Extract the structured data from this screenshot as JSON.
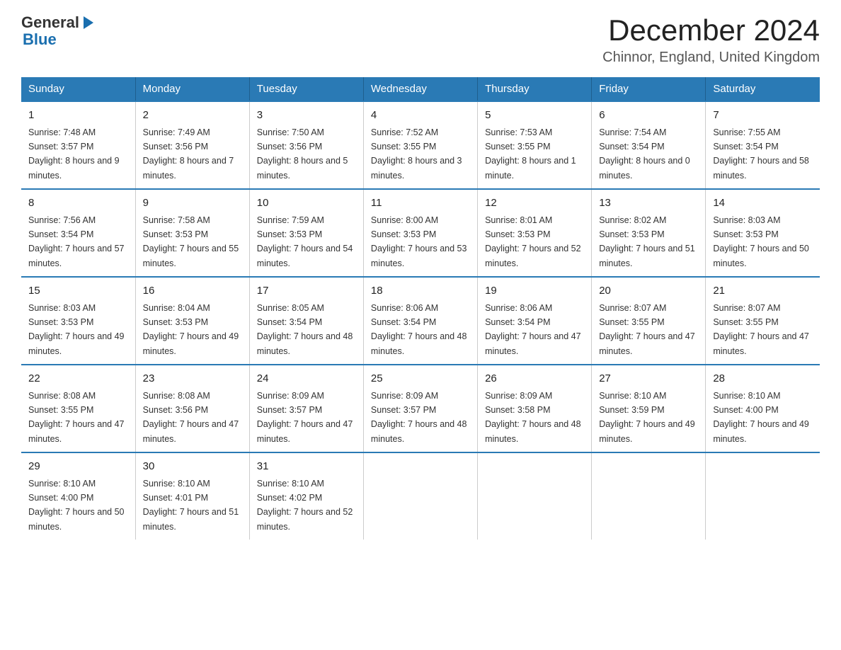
{
  "header": {
    "logo_general": "General",
    "logo_blue": "Blue",
    "title": "December 2024",
    "subtitle": "Chinnor, England, United Kingdom"
  },
  "weekdays": [
    "Sunday",
    "Monday",
    "Tuesday",
    "Wednesday",
    "Thursday",
    "Friday",
    "Saturday"
  ],
  "weeks": [
    [
      {
        "day": "1",
        "sunrise": "7:48 AM",
        "sunset": "3:57 PM",
        "daylight": "8 hours and 9 minutes."
      },
      {
        "day": "2",
        "sunrise": "7:49 AM",
        "sunset": "3:56 PM",
        "daylight": "8 hours and 7 minutes."
      },
      {
        "day": "3",
        "sunrise": "7:50 AM",
        "sunset": "3:56 PM",
        "daylight": "8 hours and 5 minutes."
      },
      {
        "day": "4",
        "sunrise": "7:52 AM",
        "sunset": "3:55 PM",
        "daylight": "8 hours and 3 minutes."
      },
      {
        "day": "5",
        "sunrise": "7:53 AM",
        "sunset": "3:55 PM",
        "daylight": "8 hours and 1 minute."
      },
      {
        "day": "6",
        "sunrise": "7:54 AM",
        "sunset": "3:54 PM",
        "daylight": "8 hours and 0 minutes."
      },
      {
        "day": "7",
        "sunrise": "7:55 AM",
        "sunset": "3:54 PM",
        "daylight": "7 hours and 58 minutes."
      }
    ],
    [
      {
        "day": "8",
        "sunrise": "7:56 AM",
        "sunset": "3:54 PM",
        "daylight": "7 hours and 57 minutes."
      },
      {
        "day": "9",
        "sunrise": "7:58 AM",
        "sunset": "3:53 PM",
        "daylight": "7 hours and 55 minutes."
      },
      {
        "day": "10",
        "sunrise": "7:59 AM",
        "sunset": "3:53 PM",
        "daylight": "7 hours and 54 minutes."
      },
      {
        "day": "11",
        "sunrise": "8:00 AM",
        "sunset": "3:53 PM",
        "daylight": "7 hours and 53 minutes."
      },
      {
        "day": "12",
        "sunrise": "8:01 AM",
        "sunset": "3:53 PM",
        "daylight": "7 hours and 52 minutes."
      },
      {
        "day": "13",
        "sunrise": "8:02 AM",
        "sunset": "3:53 PM",
        "daylight": "7 hours and 51 minutes."
      },
      {
        "day": "14",
        "sunrise": "8:03 AM",
        "sunset": "3:53 PM",
        "daylight": "7 hours and 50 minutes."
      }
    ],
    [
      {
        "day": "15",
        "sunrise": "8:03 AM",
        "sunset": "3:53 PM",
        "daylight": "7 hours and 49 minutes."
      },
      {
        "day": "16",
        "sunrise": "8:04 AM",
        "sunset": "3:53 PM",
        "daylight": "7 hours and 49 minutes."
      },
      {
        "day": "17",
        "sunrise": "8:05 AM",
        "sunset": "3:54 PM",
        "daylight": "7 hours and 48 minutes."
      },
      {
        "day": "18",
        "sunrise": "8:06 AM",
        "sunset": "3:54 PM",
        "daylight": "7 hours and 48 minutes."
      },
      {
        "day": "19",
        "sunrise": "8:06 AM",
        "sunset": "3:54 PM",
        "daylight": "7 hours and 47 minutes."
      },
      {
        "day": "20",
        "sunrise": "8:07 AM",
        "sunset": "3:55 PM",
        "daylight": "7 hours and 47 minutes."
      },
      {
        "day": "21",
        "sunrise": "8:07 AM",
        "sunset": "3:55 PM",
        "daylight": "7 hours and 47 minutes."
      }
    ],
    [
      {
        "day": "22",
        "sunrise": "8:08 AM",
        "sunset": "3:55 PM",
        "daylight": "7 hours and 47 minutes."
      },
      {
        "day": "23",
        "sunrise": "8:08 AM",
        "sunset": "3:56 PM",
        "daylight": "7 hours and 47 minutes."
      },
      {
        "day": "24",
        "sunrise": "8:09 AM",
        "sunset": "3:57 PM",
        "daylight": "7 hours and 47 minutes."
      },
      {
        "day": "25",
        "sunrise": "8:09 AM",
        "sunset": "3:57 PM",
        "daylight": "7 hours and 48 minutes."
      },
      {
        "day": "26",
        "sunrise": "8:09 AM",
        "sunset": "3:58 PM",
        "daylight": "7 hours and 48 minutes."
      },
      {
        "day": "27",
        "sunrise": "8:10 AM",
        "sunset": "3:59 PM",
        "daylight": "7 hours and 49 minutes."
      },
      {
        "day": "28",
        "sunrise": "8:10 AM",
        "sunset": "4:00 PM",
        "daylight": "7 hours and 49 minutes."
      }
    ],
    [
      {
        "day": "29",
        "sunrise": "8:10 AM",
        "sunset": "4:00 PM",
        "daylight": "7 hours and 50 minutes."
      },
      {
        "day": "30",
        "sunrise": "8:10 AM",
        "sunset": "4:01 PM",
        "daylight": "7 hours and 51 minutes."
      },
      {
        "day": "31",
        "sunrise": "8:10 AM",
        "sunset": "4:02 PM",
        "daylight": "7 hours and 52 minutes."
      },
      null,
      null,
      null,
      null
    ]
  ]
}
